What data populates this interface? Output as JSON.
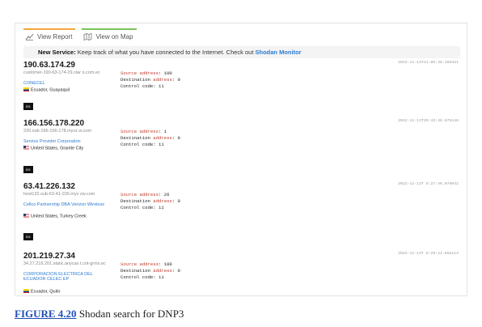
{
  "tabs": [
    {
      "label": "View Report",
      "icon": "report-chart-icon"
    },
    {
      "label": "View on Map",
      "icon": "map-icon"
    }
  ],
  "banner": {
    "strong": "New Service:",
    "text": " Keep track of what you have connected to the Internet. Check out ",
    "link": "Shodan Monitor"
  },
  "results": [
    {
      "ip": "190.63.174.29",
      "hostname": "customer-190-63-174-29.clar o.com.ec",
      "org": "CONECEL",
      "location": "Ecuador, Guayaquil",
      "flag": "ecuador-flag-icon",
      "tag": "ics",
      "timestamp": "2022-11-13T21:06:48.169321",
      "source_label": "Source address",
      "source_value": ": 100",
      "dest_label": "Destination ",
      "dest_key": "address",
      "dest_value": ": 0",
      "control": "Control code: 11"
    },
    {
      "ip": "166.156.178.220",
      "hostname": "220.sub-166-156-178.myvz w.com",
      "org": "Service Provider Corporation",
      "location": "United States, Granite City",
      "flag": "united-states-flag-icon",
      "tag": "ics",
      "timestamp": "2022-11-13T20:43:48.575148",
      "source_label": "Source address",
      "source_value": ": 1",
      "dest_label": "Destination ",
      "dest_key": "address",
      "dest_value": ": 0",
      "control": "Control code: 11"
    },
    {
      "ip": "63.41.226.132",
      "hostname": "host132.sub-63-41-226.myv zw.com",
      "org": "Cellco Partnership DBA Verizon Wireless",
      "location": "United States, Turkey Creek",
      "flag": "united-states-flag-icon",
      "tag": "ics",
      "timestamp": "2022-11-13T 8:27:46.078042",
      "source_label": "Source address",
      "source_value": ": 26",
      "dest_label": "Destination ",
      "dest_key": "address",
      "dest_value": ": 0",
      "control": "Control code: 11"
    },
    {
      "ip": "201.219.27.34",
      "hostname": "34.27.219.201.static.anycas t.cnt-grms.ec",
      "org": "CORPORACION ELECTRICA DEL ECUADOR CELEC EP",
      "location": "Ecuador, Quito",
      "flag": "ecuador-flag-icon",
      "tag": "",
      "timestamp": "2022-11-13T 8:29:23.866114",
      "source_label": "Source address",
      "source_value": ": 100",
      "dest_label": "Destination ",
      "dest_key": "address",
      "dest_value": ": 0",
      "control": "Control code: 11"
    }
  ],
  "caption": {
    "figure": "FIGURE 4.20",
    "text": " Shodan search for DNP3"
  },
  "colors": {
    "link": "#2b7bd1",
    "report_tab_accent": "#f0a540",
    "map_tab_accent": "#7bc25b",
    "banner_key": "#c0392b",
    "caption_figure": "#1f4fb5"
  }
}
